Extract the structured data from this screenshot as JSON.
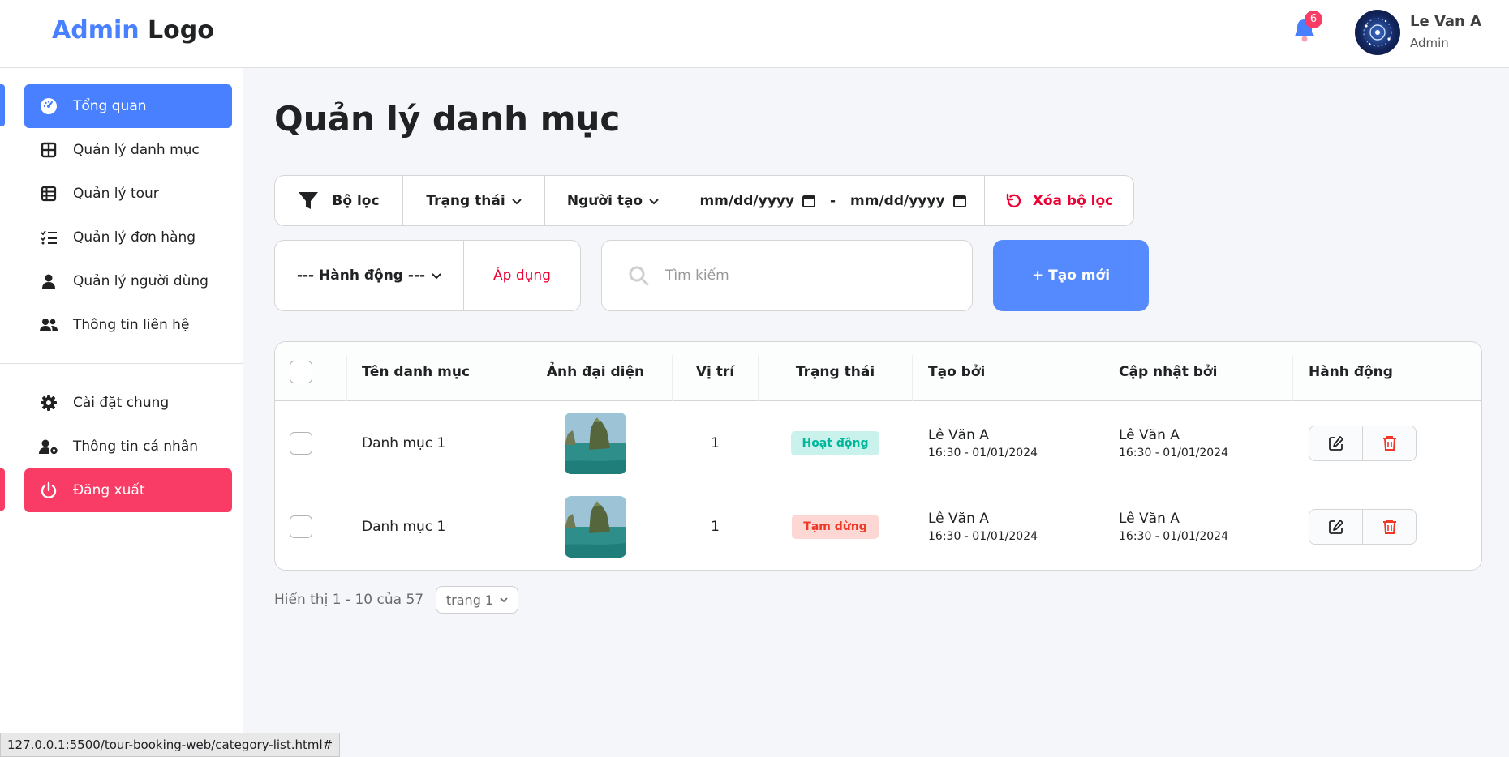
{
  "header": {
    "logo_part1": "Admin",
    "logo_part2": "Logo",
    "notification_count": "6",
    "user_name": "Le Van A",
    "user_role": "Admin"
  },
  "sidebar": {
    "items": [
      {
        "label": "Tổng quan",
        "icon": "dashboard-icon"
      },
      {
        "label": "Quản lý danh mục",
        "icon": "grid-icon"
      },
      {
        "label": "Quản lý tour",
        "icon": "table-icon"
      },
      {
        "label": "Quản lý đơn hàng",
        "icon": "checklist-icon"
      },
      {
        "label": "Quản lý người dùng",
        "icon": "user-icon"
      },
      {
        "label": "Thông tin liên hệ",
        "icon": "users-icon"
      }
    ],
    "bottom_items": [
      {
        "label": "Cài đặt chung",
        "icon": "gear-icon"
      },
      {
        "label": "Thông tin cá nhân",
        "icon": "user-cog-icon"
      },
      {
        "label": "Đăng xuất",
        "icon": "power-icon"
      }
    ]
  },
  "main": {
    "title": "Quản lý danh mục",
    "filter": {
      "label": "Bộ lọc",
      "status": "Trạng thái",
      "creator": "Người tạo",
      "date_from": "mm/dd/yyyy",
      "date_sep": "-",
      "date_to": "mm/dd/yyyy",
      "reset": "Xóa bộ lọc"
    },
    "action": {
      "select": "--- Hành động ---",
      "apply": "Áp dụng"
    },
    "search": {
      "placeholder": "Tìm kiếm"
    },
    "create_label": "+ Tạo mới",
    "table": {
      "headers": [
        "Tên danh mục",
        "Ảnh đại diện",
        "Vị trí",
        "Trạng thái",
        "Tạo bởi",
        "Cập nhật bởi",
        "Hành động"
      ],
      "rows": [
        {
          "name": "Danh mục 1",
          "position": "1",
          "status": "Hoạt động",
          "created_by": "Lê Văn A",
          "created_at": "16:30 - 01/01/2024",
          "updated_by": "Lê Văn A",
          "updated_at": "16:30 - 01/01/2024"
        },
        {
          "name": "Danh mục 1",
          "position": "1",
          "status": "Tạm dừng",
          "created_by": "Lê Văn A",
          "created_at": "16:30 - 01/01/2024",
          "updated_by": "Lê Văn A",
          "updated_at": "16:30 - 01/01/2024"
        }
      ]
    },
    "pager": {
      "summary": "Hiển thị 1 - 10 của 57",
      "page": "trang 1"
    }
  },
  "status_bar": {
    "url": "127.0.0.1:5500/tour-booking-web/category-list.html#"
  },
  "colors": {
    "accent": "#4880ff",
    "danger": "#f93c65",
    "active_badge": "#00b69b",
    "paused_badge": "#ef3826"
  }
}
